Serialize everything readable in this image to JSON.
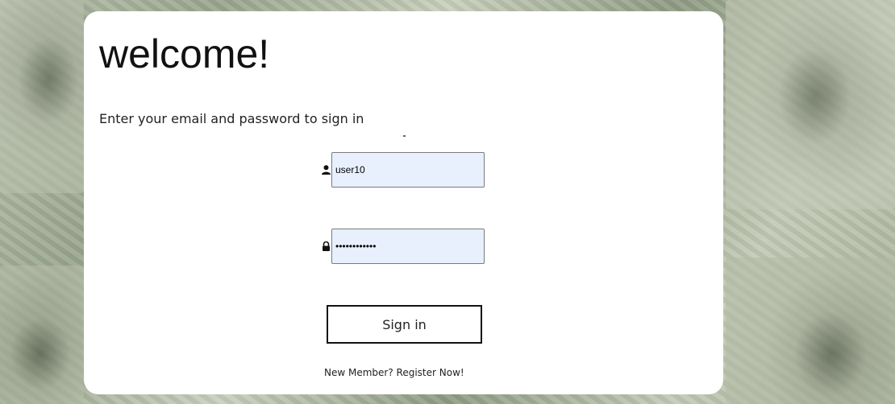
{
  "page": {
    "title": "welcome!",
    "subtitle": "Enter your email and password to sign in"
  },
  "form": {
    "username": {
      "value": "user10",
      "icon": "user-icon"
    },
    "password": {
      "value": "••••••••••••",
      "icon": "lock-icon"
    },
    "signin_label": "Sign in",
    "register_link": "New Member? Register Now!"
  },
  "colors": {
    "input_bg": "#e8f0fe",
    "card_bg": "#ffffff"
  }
}
